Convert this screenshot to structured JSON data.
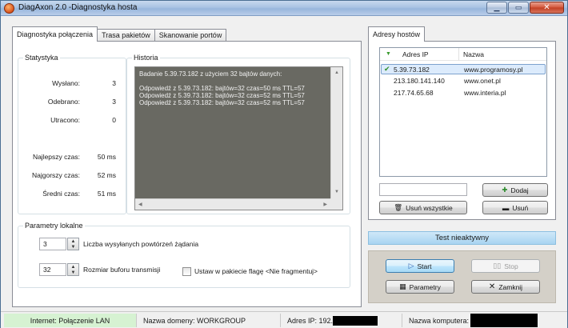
{
  "window": {
    "title": "DiagAxon 2.0 -Diagnostyka hosta",
    "minimize_label": "▁",
    "maximize_label": "▭",
    "close_label": "✕"
  },
  "left_tabs": [
    {
      "label": "Diagnostyka połączenia",
      "active": true
    },
    {
      "label": "Trasa pakietów",
      "active": false
    },
    {
      "label": "Skanowanie portów",
      "active": false
    }
  ],
  "statistics": {
    "group_label": "Statystyka",
    "rows": [
      {
        "label": "Wysłano:",
        "value": "3"
      },
      {
        "label": "Odebrano:",
        "value": "3"
      },
      {
        "label": "Utracono:",
        "value": "0"
      },
      {
        "label": "Najlepszy czas:",
        "value": "50 ms"
      },
      {
        "label": "Najgorszy czas:",
        "value": "52 ms"
      },
      {
        "label": "Średni czas:",
        "value": "51 ms"
      }
    ]
  },
  "history": {
    "group_label": "Historia",
    "lines": [
      "Badanie 5.39.73.182 z użyciem 32 bajtów danych:",
      "",
      "Odpowiedź z 5.39.73.182: bajtów=32 czas=50 ms TTL=57",
      "Odpowiedź z 5.39.73.182: bajtów=32 czas=52 ms TTL=57",
      "Odpowiedź z 5.39.73.182: bajtów=32 czas=52 ms TTL=57"
    ]
  },
  "local_params": {
    "group_label": "Parametry lokalne",
    "repeat_value": "3",
    "repeat_label": "Liczba wysyłanych powtórzeń żądania",
    "buffer_value": "32",
    "buffer_label": "Rozmiar buforu transmisji",
    "dont_fragment_label": "Ustaw w pakiecie flagę <Nie fragmentuj>",
    "dont_fragment_checked": false
  },
  "hosts": {
    "tab_label": "Adresy hostów",
    "col_ip": "Adres IP",
    "col_name": "Nazwa",
    "rows": [
      {
        "ip": "5.39.73.182",
        "name": "www.programosy.pl",
        "selected": true
      },
      {
        "ip": "213.180.141.140",
        "name": "www.onet.pl",
        "selected": false
      },
      {
        "ip": "217.74.65.68",
        "name": "www.interia.pl",
        "selected": false
      }
    ],
    "new_host_value": "",
    "add_label": "Dodaj",
    "remove_all_label": "Usuń wszystkie",
    "remove_label": "Usuń"
  },
  "test_status": "Test nieaktywny",
  "controls": {
    "start_label": "Start",
    "stop_label": "Stop",
    "params_label": "Parametry",
    "close_label": "Zamknij"
  },
  "statusbar": {
    "internet": "Internet: Połączenie LAN",
    "domain": "Nazwa domeny: WORKGROUP",
    "ip": "Adres IP: 192.",
    "computer": "Nazwa komputera:"
  },
  "colors": {
    "log_background": "#696962",
    "internet_status": "#d6f2d2",
    "test_status": "#a8d4f1",
    "selected_row": "#dcebfc"
  }
}
